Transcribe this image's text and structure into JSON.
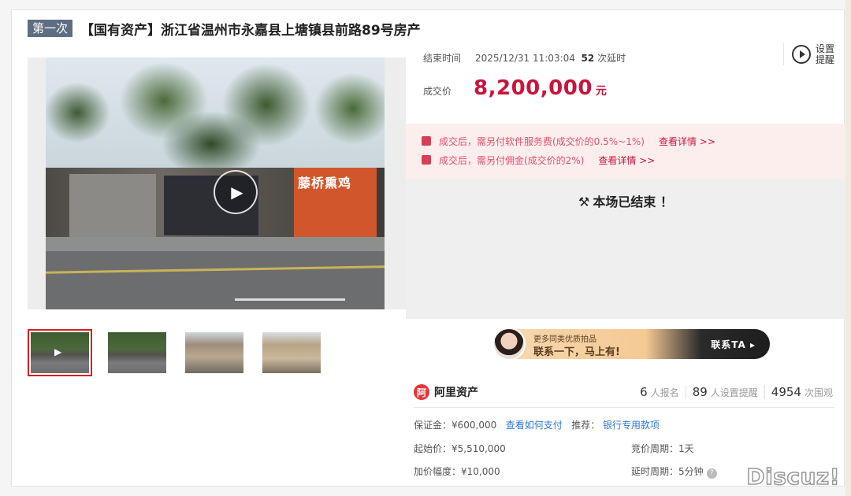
{
  "title": {
    "round": "第一次",
    "name": "【国有资产】浙江省温州市永嘉县上塘镇县前路89号房产"
  },
  "viewer": {
    "shop_sign": "藤桥熏鸡"
  },
  "thumbnails": [
    {
      "kind": "video"
    },
    {
      "kind": "street"
    },
    {
      "kind": "house"
    },
    {
      "kind": "house"
    }
  ],
  "auction": {
    "end_label": "结束时间",
    "end_time": "2025/12/31 11:03:04",
    "extend_count": "52",
    "extend_label": "次延时",
    "reminder_label": "设置提醒",
    "price_label": "成交价",
    "price": "8,200,000",
    "price_unit": "元",
    "accent_color": "#c9153d"
  },
  "notices": [
    {
      "text": "成交后，需另付软件服务费(成交价的0.5%~1%)",
      "link": "查看详情 >>"
    },
    {
      "text": "成交后，需另付佣金(成交价的2%)",
      "link": "查看详情 >>"
    }
  ],
  "ended_text": "本场已结束 ！",
  "banner": {
    "small": "更多同类优质拍品",
    "big": "联系一下，马上有!",
    "cta": "联系TA ▸"
  },
  "platform": {
    "name": "阿里资产",
    "logo_glyph": "阿"
  },
  "stats": [
    {
      "num": "6",
      "label": "人报名"
    },
    {
      "num": "89",
      "label": "人设置提醒"
    },
    {
      "num": "4954",
      "label": "次围观"
    }
  ],
  "details": {
    "deposit": "保证金：¥600,000",
    "deposit_link": "查看如何支付",
    "recommend_label": "推荐：",
    "recommend_link": "银行专用款项",
    "start_price": "起始价：¥5,510,000",
    "bid_period": "竞价周期：1天",
    "increment": "加价幅度：¥10,000",
    "delay_period": "延时周期：5分钟"
  },
  "watermark": "Discuz!"
}
